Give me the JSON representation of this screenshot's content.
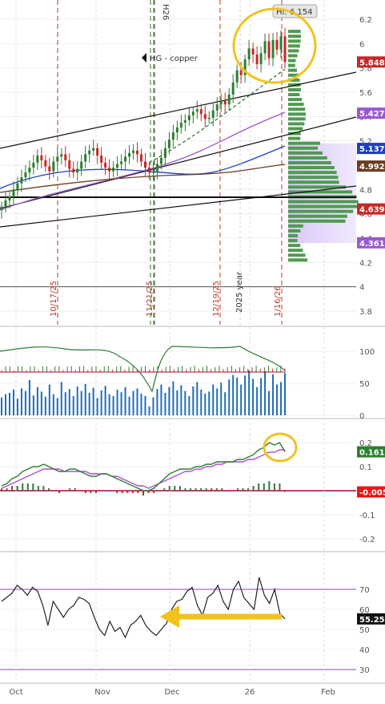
{
  "symbol_label": "HG - copper",
  "hi_label": "Hi: 6.154",
  "top_marker": "H26",
  "year_marker": "2025 year",
  "dates": [
    "10/17/25",
    "11/21/25",
    "12/19/25",
    "1/16/26"
  ],
  "x_axis_labels": [
    "Oct",
    "Nov",
    "Dec",
    "26",
    "Feb"
  ],
  "colors": {
    "up": "#2e7d32",
    "down": "#c62828",
    "accent": "#f2c21b",
    "volume": "#1f6db5",
    "macd_signal": "#b04fd1",
    "rsi": "#222222"
  },
  "price_tags": [
    {
      "value": "5.8485",
      "bg": "#c62828",
      "fg": "#ffffff"
    },
    {
      "value": "5.4278",
      "bg": "#9b59d0",
      "fg": "#ffffff"
    },
    {
      "value": "5.1379",
      "bg": "#1f3fbf",
      "fg": "#ffffff"
    },
    {
      "value": "4.9925",
      "bg": "#6b3e1f",
      "fg": "#ffffff"
    },
    {
      "value": "4.6399",
      "bg": "#c62828",
      "fg": "#ffffff"
    },
    {
      "value": "4.3618",
      "bg": "#9b59d0",
      "fg": "#ffffff"
    }
  ],
  "macd_tags": [
    {
      "value": "0.1617",
      "bg": "#2e7d32",
      "fg": "#ffffff"
    },
    {
      "value": "-0.005",
      "bg": "#e81515",
      "fg": "#ffffff"
    }
  ],
  "rsi_tag": {
    "value": "55.25",
    "bg": "#111111",
    "fg": "#ffffff"
  },
  "chart_data": [
    {
      "type": "candlestick",
      "panel": "price",
      "title": "HG - copper",
      "y_ticks": [
        3.8,
        4,
        4.2,
        4.4,
        4.6,
        4.8,
        5,
        5.2,
        5.4,
        5.6,
        5.8,
        6,
        6.2
      ],
      "ylim": [
        3.72,
        6.28
      ],
      "grid": true,
      "series": [
        {
          "name": "HG - copper",
          "close": [
            4.66,
            4.71,
            4.74,
            4.8,
            4.85,
            4.9,
            4.94,
            4.98,
            5.02,
            5.08,
            5.04,
            4.99,
            4.95,
            5.03,
            5.07,
            5.09,
            5.04,
            4.97,
            4.94,
            4.97,
            5.03,
            5.09,
            5.12,
            5.14,
            5.08,
            5.02,
            4.98,
            4.95,
            4.98,
            5.01,
            5.03,
            5.07,
            5.1,
            5.12,
            5.09,
            5.03,
            4.98,
            4.94,
            4.95,
            5.01,
            5.06,
            5.14,
            5.21,
            5.27,
            5.31,
            5.35,
            5.37,
            5.41,
            5.44,
            5.46,
            5.42,
            5.38,
            5.39,
            5.45,
            5.5,
            5.53,
            5.5,
            5.58,
            5.68,
            5.78,
            5.74,
            5.87,
            5.96,
            5.91,
            5.83,
            5.92,
            6.02,
            5.88,
            6.03,
            5.95,
            6.06,
            5.8485
          ]
        }
      ]
    },
    {
      "type": "bar",
      "panel": "volume",
      "y_ticks": [
        0,
        50,
        100
      ],
      "ylim": [
        0,
        120
      ],
      "series": [
        {
          "name": "volume",
          "values": [
            28,
            33,
            35,
            40,
            26,
            42,
            38,
            55,
            31,
            44,
            37,
            29,
            48,
            33,
            27,
            52,
            36,
            41,
            30,
            45,
            38,
            49,
            35,
            43,
            27,
            39,
            46,
            33,
            30,
            40,
            36,
            44,
            29,
            38,
            42,
            34,
            30,
            14,
            28,
            41,
            48,
            35,
            44,
            53,
            39,
            47,
            38,
            30,
            45,
            52,
            40,
            34,
            37,
            48,
            42,
            51,
            36,
            56,
            63,
            59,
            48,
            62,
            70,
            57,
            44,
            58,
            69,
            38,
            64,
            48,
            52,
            66
          ]
        }
      ]
    },
    {
      "type": "line",
      "panel": "macd",
      "y_ticks": [
        -0.2,
        -0.1,
        0,
        0.1,
        0.2
      ],
      "ylim": [
        -0.26,
        0.24
      ],
      "series": [
        {
          "name": "macd",
          "values": [
            0.02,
            0.03,
            0.05,
            0.06,
            0.08,
            0.09,
            0.1,
            0.1,
            0.11,
            0.1,
            0.09,
            0.08,
            0.08,
            0.09,
            0.09,
            0.08,
            0.07,
            0.06,
            0.06,
            0.07,
            0.07,
            0.06,
            0.05,
            0.04,
            0.03,
            0.02,
            0.01,
            0.0,
            0.0,
            0.01,
            0.03,
            0.05,
            0.07,
            0.08,
            0.09,
            0.09,
            0.09,
            0.1,
            0.1,
            0.11,
            0.11,
            0.12,
            0.12,
            0.12,
            0.12,
            0.13,
            0.13,
            0.14,
            0.15,
            0.17,
            0.18,
            0.2,
            0.19,
            0.2,
            0.1617
          ]
        },
        {
          "name": "signal",
          "values": [
            0.01,
            0.02,
            0.03,
            0.04,
            0.05,
            0.06,
            0.07,
            0.08,
            0.09,
            0.09,
            0.09,
            0.09,
            0.08,
            0.08,
            0.08,
            0.08,
            0.08,
            0.07,
            0.07,
            0.07,
            0.07,
            0.06,
            0.06,
            0.05,
            0.04,
            0.03,
            0.02,
            0.02,
            0.01,
            0.02,
            0.03,
            0.04,
            0.05,
            0.06,
            0.07,
            0.08,
            0.08,
            0.09,
            0.09,
            0.1,
            0.1,
            0.11,
            0.11,
            0.12,
            0.12,
            0.12,
            0.12,
            0.13,
            0.13,
            0.14,
            0.15,
            0.16,
            0.16,
            0.17,
            0.17
          ]
        },
        {
          "name": "histogram",
          "values": [
            0.01,
            0.01,
            0.02,
            0.02,
            0.03,
            0.03,
            0.03,
            0.02,
            0.02,
            0.01,
            0.0,
            -0.01,
            0.0,
            0.01,
            0.01,
            0.0,
            -0.01,
            -0.01,
            -0.01,
            0.0,
            0.0,
            0.0,
            -0.01,
            -0.01,
            -0.01,
            -0.01,
            -0.01,
            -0.02,
            -0.01,
            -0.01,
            0.0,
            0.01,
            0.02,
            0.02,
            0.02,
            0.01,
            0.01,
            0.01,
            0.01,
            0.01,
            0.01,
            0.01,
            0.01,
            0.0,
            0.0,
            0.01,
            0.01,
            0.01,
            0.02,
            0.03,
            0.03,
            0.04,
            0.03,
            0.03,
            -0.005
          ]
        }
      ]
    },
    {
      "type": "line",
      "panel": "rsi",
      "y_ticks": [
        30,
        40,
        50,
        60,
        70
      ],
      "ylim": [
        22,
        78
      ],
      "series": [
        {
          "name": "rsi",
          "values": [
            64,
            66,
            68,
            72,
            70,
            67,
            71,
            69,
            62,
            52,
            64,
            60,
            56,
            60,
            62,
            66,
            65,
            63,
            56,
            50,
            47,
            54,
            49,
            51,
            46,
            52,
            54,
            57,
            52,
            49,
            47,
            50,
            53,
            60,
            64,
            65,
            69,
            71,
            62,
            57,
            66,
            68,
            72,
            64,
            60,
            70,
            74,
            66,
            63,
            60,
            76,
            67,
            63,
            70,
            58,
            55.25
          ]
        }
      ]
    }
  ]
}
